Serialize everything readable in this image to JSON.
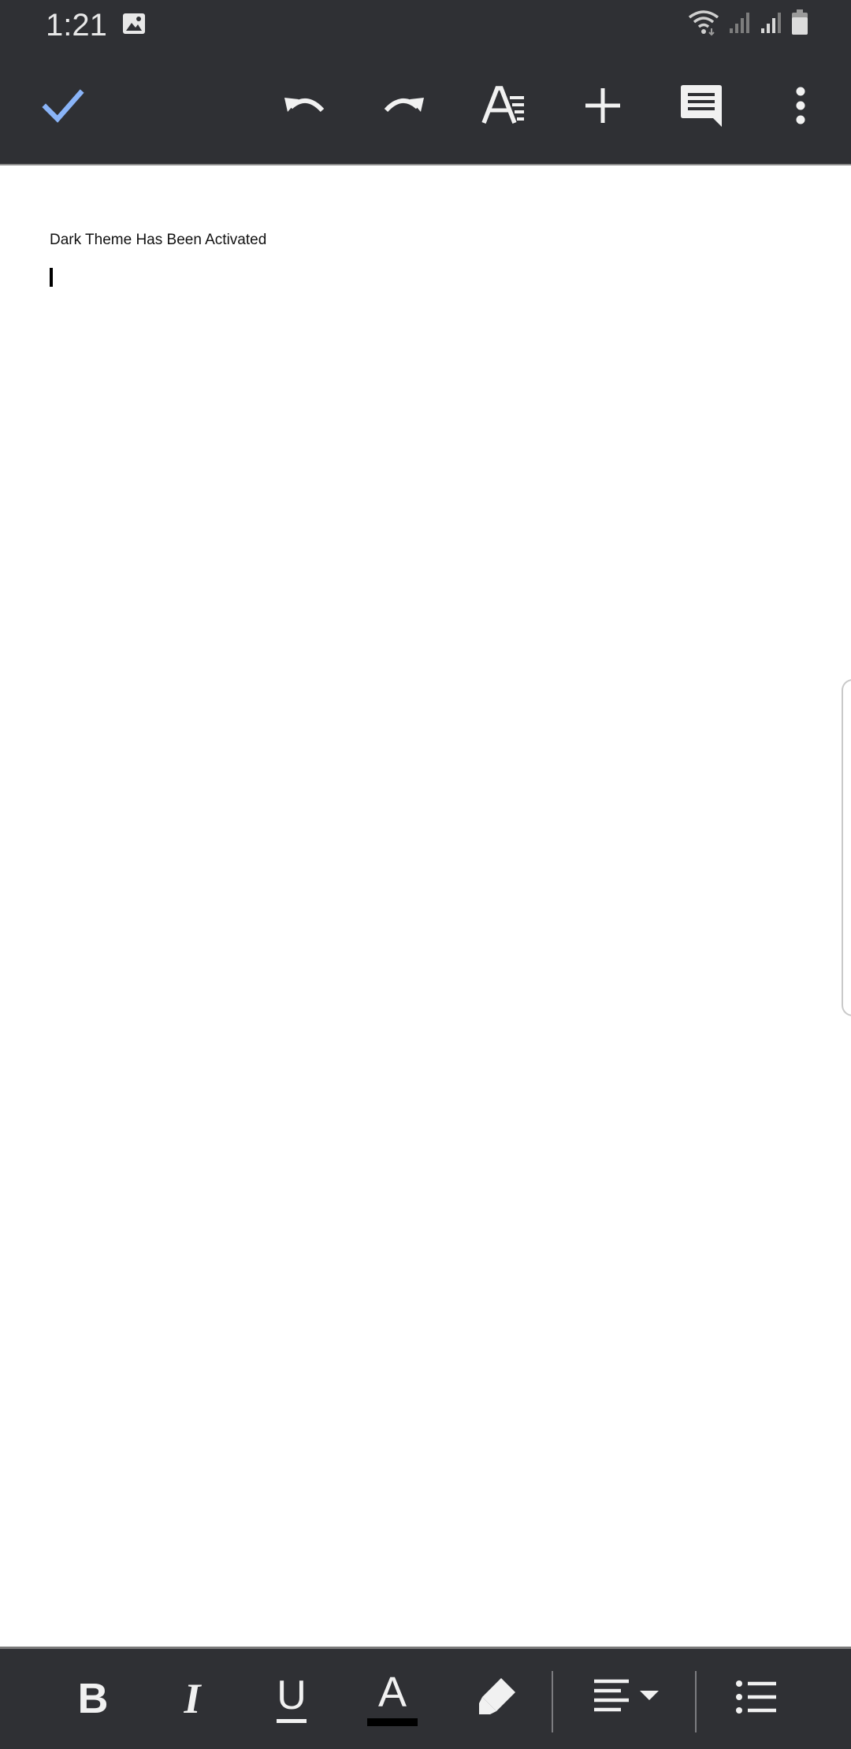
{
  "status_bar": {
    "time": "1:21",
    "icons": [
      "image-icon",
      "wifi-icon",
      "signal-icon",
      "signal-icon",
      "battery-icon"
    ]
  },
  "toolbar": {
    "done_icon": "check-icon",
    "undo_icon": "undo-icon",
    "redo_icon": "redo-icon",
    "text_format_icon": "text-format-icon",
    "insert_icon": "plus-icon",
    "comment_icon": "comment-icon",
    "more_icon": "more-vert-icon",
    "accent_color": "#8ab4f8"
  },
  "document": {
    "lines": [
      "Dark Theme Has Been Activated"
    ]
  },
  "format_bar": {
    "bold_label": "B",
    "italic_label": "I",
    "underline_label": "U",
    "text_color_label": "A",
    "text_color_swatch": "#000000",
    "highlight_icon": "highlighter-icon",
    "align_icon": "align-left-icon",
    "list_icon": "bulleted-list-icon"
  },
  "colors": {
    "bar_background": "#2f3034",
    "icon_color": "#f1f1f1",
    "page_background": "#ffffff"
  }
}
